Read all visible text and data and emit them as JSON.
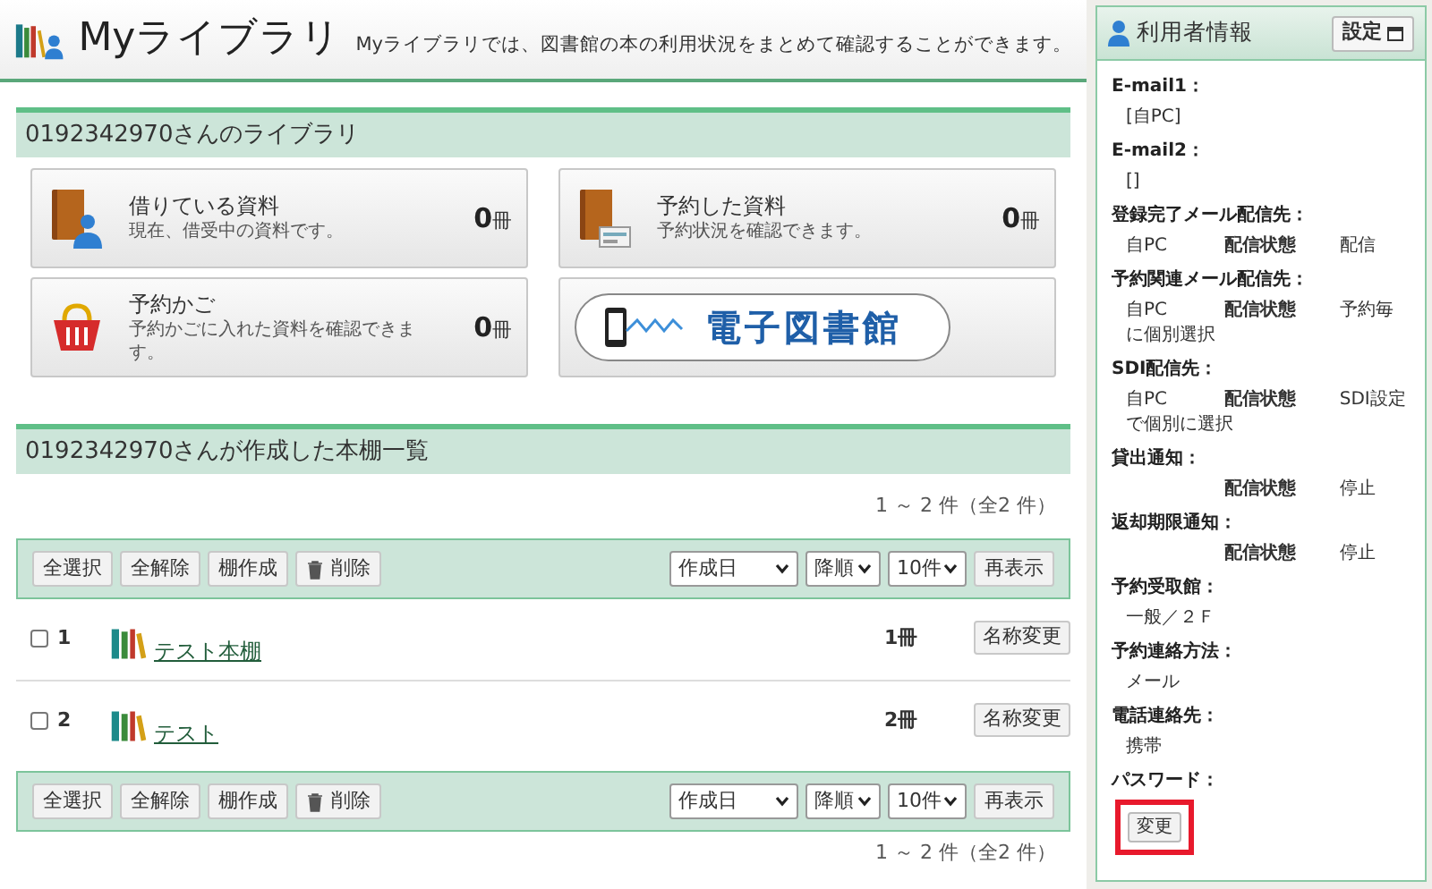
{
  "header": {
    "title": "Myライブラリ",
    "description": "Myライブラリでは、図書館の本の利用状況をまとめて確認することができます。"
  },
  "library": {
    "heading": "0192342970さんのライブラリ",
    "cards": [
      {
        "kind": "borrowed",
        "title": "借りている資料",
        "subtitle": "現在、借受中の資料です。",
        "count": "0",
        "unit": "冊"
      },
      {
        "kind": "reserved",
        "title": "予約した資料",
        "subtitle": "予約状況を確認できます。",
        "count": "0",
        "unit": "冊"
      },
      {
        "kind": "cart",
        "title": "予約かご",
        "subtitle": "予約かごに入れた資料を確認できます。",
        "count": "0",
        "unit": "冊"
      },
      {
        "kind": "banner",
        "title": "電子図書館"
      }
    ]
  },
  "shelves": {
    "heading": "0192342970さんが作成した本棚一覧",
    "range_top": "1 ～ 2 件（全2 件）",
    "toolbar_top": {
      "buttons": [
        {
          "kind": "text",
          "label": "全選択"
        },
        {
          "kind": "text",
          "label": "全解除"
        },
        {
          "kind": "text",
          "label": "棚作成"
        },
        {
          "kind": "delete",
          "label": "削除"
        }
      ],
      "selects": [
        "作成日",
        "降順",
        "10件"
      ],
      "refresh": "再表示"
    },
    "rows": [
      {
        "number": "1",
        "name": "テスト本棚",
        "count": "1冊",
        "rename": "名称変更",
        "checked": false
      },
      {
        "number": "2",
        "name": "テスト",
        "count": "2冊",
        "rename": "名称変更",
        "checked": false
      }
    ],
    "toolbar_bottom": {
      "buttons": [
        {
          "kind": "text",
          "label": "全選択"
        },
        {
          "kind": "text",
          "label": "全解除"
        },
        {
          "kind": "text",
          "label": "棚作成"
        },
        {
          "kind": "delete",
          "label": "削除"
        }
      ],
      "selects": [
        "作成日",
        "降順",
        "10件"
      ],
      "refresh": "再表示"
    },
    "range_bottom": "1 ～ 2 件（全2 件）"
  },
  "sidebar": {
    "title": "利用者情報",
    "settings_button": "設定",
    "sections": [
      {
        "label": "E-mail1：",
        "value": "[自PC]"
      },
      {
        "label": "E-mail2：",
        "value": "[]"
      },
      {
        "label": "登録完了メール配信先：",
        "target": "自PC",
        "status_label": "配信状態",
        "status": "配信"
      },
      {
        "label": "予約関連メール配信先：",
        "target": "自PC",
        "status_label": "配信状態",
        "status": "予約毎に個別選択"
      },
      {
        "label": "SDI配信先：",
        "target": "自PC",
        "status_label": "配信状態",
        "status": "SDI設定で個別に選択"
      },
      {
        "label": "貸出通知：",
        "status_label": "配信状態",
        "status": "停止"
      },
      {
        "label": "返却期限通知：",
        "status_label": "配信状態",
        "status": "停止"
      },
      {
        "label": "予約受取館：",
        "value": "一般／２Ｆ"
      },
      {
        "label": "予約連絡方法：",
        "value": "メール"
      },
      {
        "label": "電話連絡先：",
        "value": "携帯"
      }
    ],
    "password": {
      "label": "パスワード：",
      "button": "変更",
      "highlighted": true
    }
  }
}
